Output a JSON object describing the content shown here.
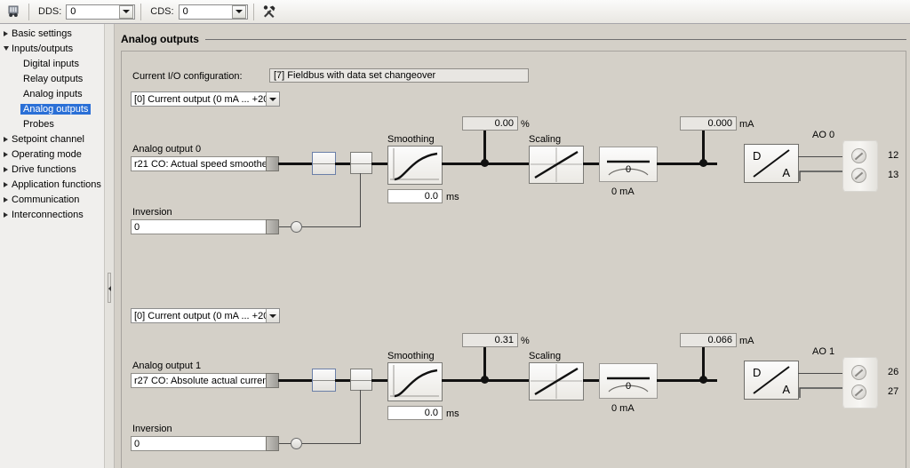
{
  "toolbar": {
    "device_icon": "drive-rack-icon",
    "dds_label": "DDS:",
    "dds_value": "0",
    "cds_label": "CDS:",
    "cds_value": "0",
    "tools_icon": "hammer-wrench-icon"
  },
  "sidebar": {
    "items": [
      {
        "label": "Basic settings",
        "level": 0,
        "expander": "collapsed",
        "selected": false
      },
      {
        "label": "Inputs/outputs",
        "level": 0,
        "expander": "expanded",
        "selected": false
      },
      {
        "label": "Digital inputs",
        "level": 1,
        "expander": "none",
        "selected": false
      },
      {
        "label": "Relay outputs",
        "level": 1,
        "expander": "none",
        "selected": false
      },
      {
        "label": "Analog inputs",
        "level": 1,
        "expander": "none",
        "selected": false
      },
      {
        "label": "Analog outputs",
        "level": 1,
        "expander": "none",
        "selected": true
      },
      {
        "label": "Probes",
        "level": 1,
        "expander": "none",
        "selected": false
      },
      {
        "label": "Setpoint channel",
        "level": 0,
        "expander": "collapsed",
        "selected": false
      },
      {
        "label": "Operating mode",
        "level": 0,
        "expander": "collapsed",
        "selected": false
      },
      {
        "label": "Drive functions",
        "level": 0,
        "expander": "collapsed",
        "selected": false
      },
      {
        "label": "Application functions",
        "level": 0,
        "expander": "collapsed",
        "selected": false
      },
      {
        "label": "Communication",
        "level": 0,
        "expander": "collapsed",
        "selected": false
      },
      {
        "label": "Interconnections",
        "level": 0,
        "expander": "collapsed",
        "selected": false
      }
    ]
  },
  "main": {
    "page_title": "Analog outputs",
    "io_config_label": "Current I/O configuration:",
    "io_config_value": "[7] Fieldbus with data set changeover",
    "channels": [
      {
        "mode_select": "[0] Current output (0 mA ... +20",
        "title": "Analog output 0",
        "source": "r21 CO: Actual speed smoothe",
        "inversion_label": "Inversion",
        "inversion_value": "0",
        "smoothing_label": "Smoothing",
        "smoothing_value": "0.0",
        "smoothing_unit": "ms",
        "percent_value": "0.00",
        "percent_unit": "%",
        "scaling_label": "Scaling",
        "offset_value": "0",
        "offset_unit": "0 mA",
        "current_value": "0.000",
        "current_unit": "mA",
        "converter_d": "D",
        "converter_a": "A",
        "terminal_label": "AO 0",
        "terminal_numbers": [
          "12",
          "13"
        ]
      },
      {
        "mode_select": "[0] Current output (0 mA ... +20",
        "title": "Analog output 1",
        "source": "r27 CO: Absolute actual curren",
        "inversion_label": "Inversion",
        "inversion_value": "0",
        "smoothing_label": "Smoothing",
        "smoothing_value": "0.0",
        "smoothing_unit": "ms",
        "percent_value": "0.31",
        "percent_unit": "%",
        "scaling_label": "Scaling",
        "offset_value": "0",
        "offset_unit": "0 mA",
        "current_value": "0.066",
        "current_unit": "mA",
        "converter_d": "D",
        "converter_a": "A",
        "terminal_label": "AO 1",
        "terminal_numbers": [
          "26",
          "27"
        ]
      }
    ]
  },
  "colors": {
    "selection": "#2a6fd6",
    "panel_bg": "#d4d0c8",
    "wire": "#111111"
  }
}
